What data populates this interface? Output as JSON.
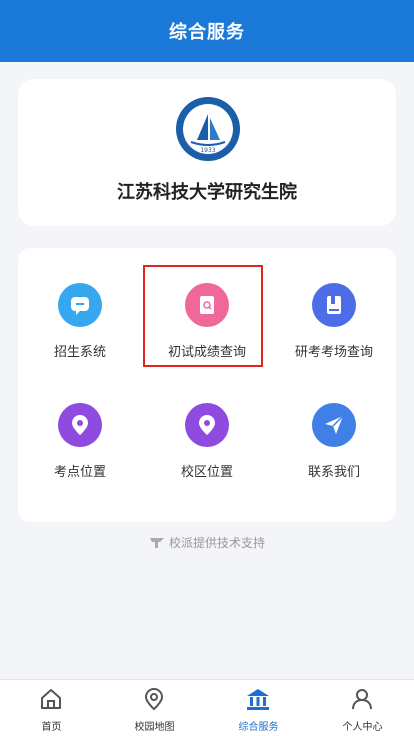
{
  "header": {
    "title": "综合服务"
  },
  "school": {
    "name": "江苏科技大学研究生院",
    "logo_year": "1933"
  },
  "services": [
    {
      "label": "招生系统",
      "icon": "message-icon",
      "color": "#37a8f0"
    },
    {
      "label": "初试成绩查询",
      "icon": "receipt-icon",
      "color": "#f0679a"
    },
    {
      "label": "研考考场查询",
      "icon": "book-icon",
      "color": "#4d6de8"
    },
    {
      "label": "考点位置",
      "icon": "location-pin-icon",
      "color": "#8f4bdf"
    },
    {
      "label": "校区位置",
      "icon": "location-pin-icon",
      "color": "#8f4bdf"
    },
    {
      "label": "联系我们",
      "icon": "paper-plane-icon",
      "color": "#3f7fe6"
    }
  ],
  "footer": {
    "note": "校派提供技术支持"
  },
  "tabbar": [
    {
      "label": "首页",
      "icon": "home-icon"
    },
    {
      "label": "校园地图",
      "icon": "map-pin-icon"
    },
    {
      "label": "综合服务",
      "icon": "building-icon",
      "active": true
    },
    {
      "label": "个人中心",
      "icon": "user-icon"
    }
  ]
}
